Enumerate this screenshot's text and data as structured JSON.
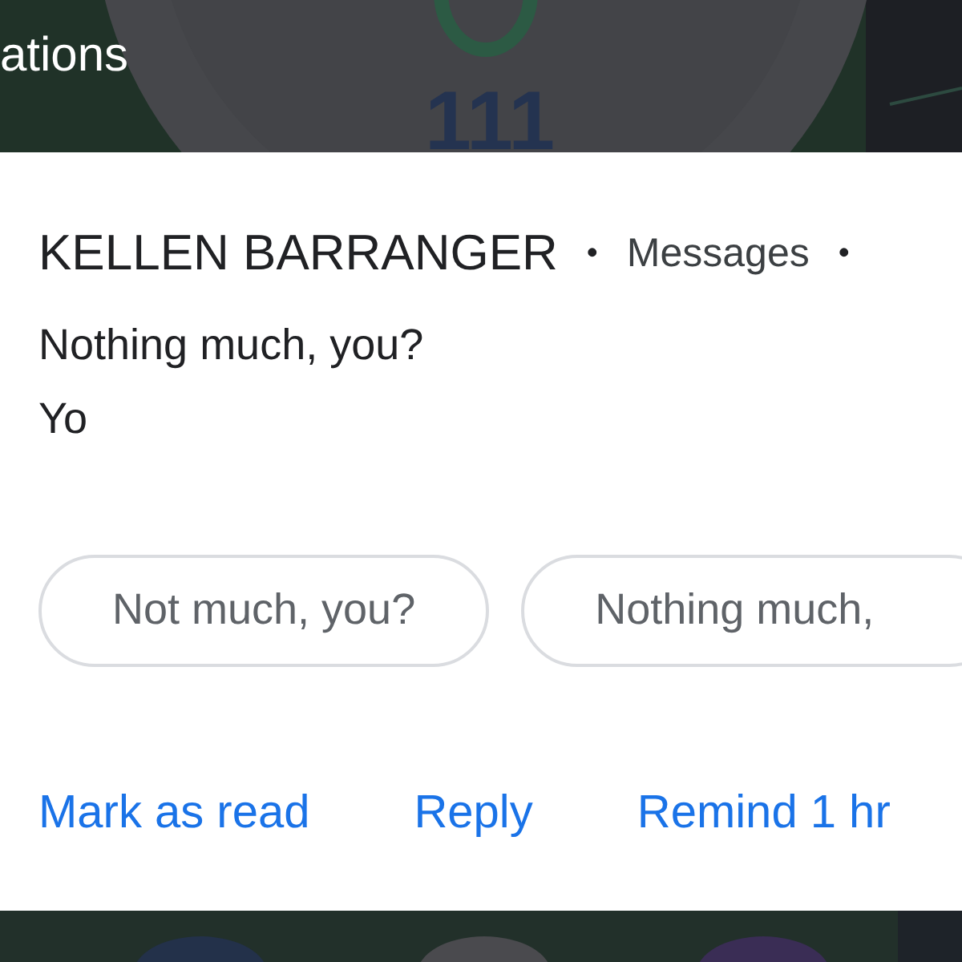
{
  "background_top": {
    "heading": "ations",
    "counter": "111"
  },
  "notification": {
    "sender": "KELLEN BARRANGER",
    "separator_1": "•",
    "app": "Messages",
    "separator_2": "•",
    "messages": [
      "Nothing much, you?",
      "Yo"
    ],
    "smart_replies": [
      "Not much, you?",
      "Nothing much,"
    ],
    "actions": [
      "Mark as read",
      "Reply",
      "Remind 1 hr"
    ]
  }
}
